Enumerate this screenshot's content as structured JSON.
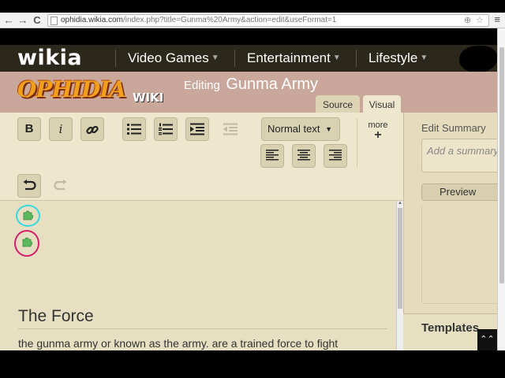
{
  "browser": {
    "url_host": "ophidia.wikia.com",
    "url_path": "/index.php?title=Gunma%20Army&action=edit&useFormat=1",
    "back_icon": "arrow-left-icon",
    "forward_icon": "arrow-right-icon",
    "reload_icon": "reload-icon",
    "zoom_icon": "magnifier-icon",
    "star_icon": "star-icon",
    "menu_icon": "hamburger-icon",
    "back_glyph": "←",
    "forward_glyph": "→",
    "reload_glyph": "C",
    "zoom_glyph": "⊕",
    "star_glyph": "☆",
    "menu_glyph": "≡"
  },
  "global_nav": {
    "logo": "wikia",
    "items": [
      {
        "label": "Video Games"
      },
      {
        "label": "Entertainment"
      },
      {
        "label": "Lifestyle"
      }
    ],
    "caret": "▼"
  },
  "wiki_header": {
    "logo_text": "OPHIDIA",
    "logo_sub": "WIKI",
    "editing_prefix": "Editing",
    "page_title": "Gunma Army"
  },
  "mode_tabs": {
    "source": "Source",
    "visual": "Visual"
  },
  "toolbar": {
    "bold": "B",
    "italic": "i",
    "format_value": "Normal text",
    "format_caret": "▼",
    "more_label": "more",
    "more_plus": "+"
  },
  "content": {
    "heading": "The Force",
    "paragraph": "the gunma army or known as the army.  are a trained force to fight"
  },
  "side_panel": {
    "edit_summary_label": "Edit Summary",
    "edit_summary_placeholder": "Add a summary",
    "preview_button": "Preview",
    "templates_heading": "Templates",
    "back_to_top": "⌃⌃"
  },
  "colors": {
    "global_nav_bg": "#2b281b",
    "wiki_header_bg": "#c9a79a",
    "toolbar_bg": "#ede7cd",
    "editor_bg": "#e6dfc2",
    "annotation_cyan": "#35d8e2",
    "annotation_magenta": "#d4206a"
  }
}
